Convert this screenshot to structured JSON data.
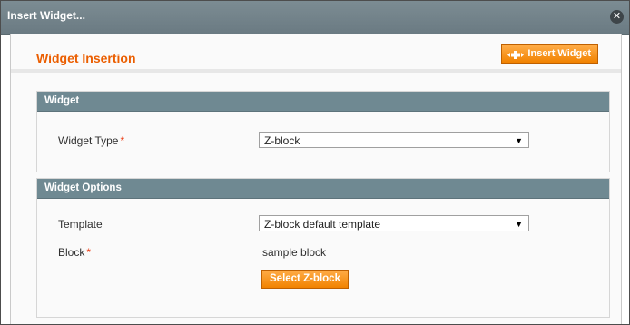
{
  "dialog": {
    "title": "Insert Widget...",
    "close_symbol": "✕"
  },
  "header": {
    "heading": "Widget Insertion",
    "insert_button_label": "Insert Widget",
    "insert_icon": "plus-arrows-icon"
  },
  "widget_section": {
    "title": "Widget",
    "type_label": "Widget Type",
    "required_mark": "*",
    "type_value": "Z-block",
    "arrow": "▼"
  },
  "options_section": {
    "title": "Widget Options",
    "template_label": "Template",
    "template_value": "Z-block default template",
    "arrow": "▼",
    "block_label": "Block",
    "required_mark": "*",
    "block_value": "sample block",
    "select_button_label": "Select Z-block"
  },
  "colors": {
    "accent_orange": "#f18200",
    "heading_orange": "#eb5e00",
    "section_header": "#6f8992",
    "required_red": "#eb340a"
  }
}
